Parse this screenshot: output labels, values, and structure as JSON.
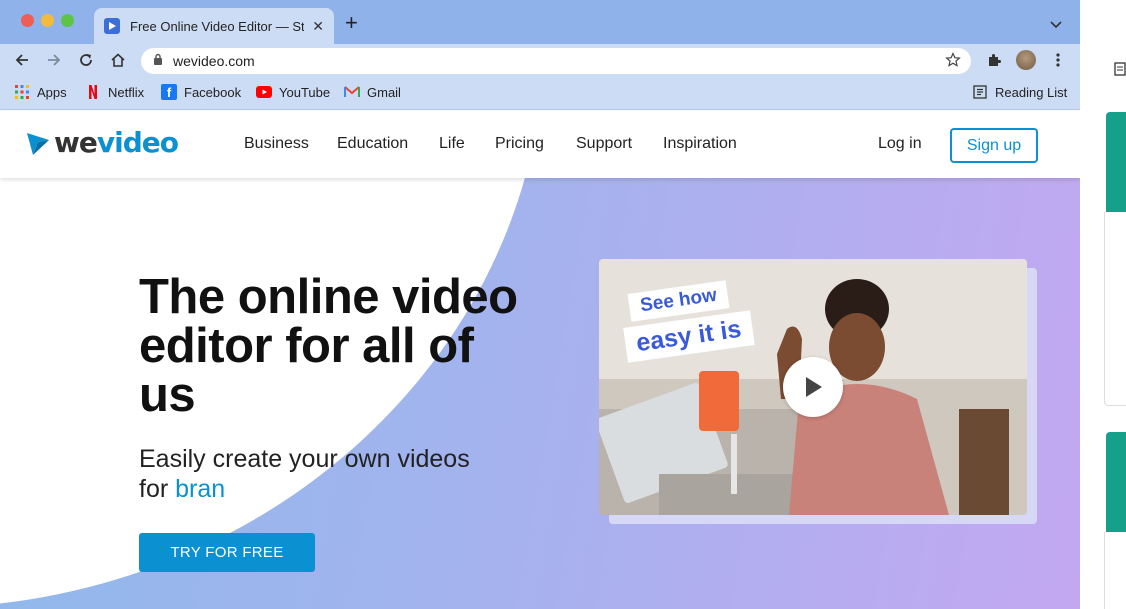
{
  "browser": {
    "tab_title": "Free Online Video Editor — Sta",
    "url": "wevideo.com",
    "bookmarks": [
      {
        "label": "Apps",
        "icon": "apps-grid-icon"
      },
      {
        "label": "Netflix",
        "icon": "netflix-icon"
      },
      {
        "label": "Facebook",
        "icon": "facebook-icon"
      },
      {
        "label": "YouTube",
        "icon": "youtube-icon"
      },
      {
        "label": "Gmail",
        "icon": "gmail-icon"
      }
    ],
    "reading_list": "Reading List"
  },
  "site": {
    "logo_we": "we",
    "logo_video": "video",
    "nav": [
      "Business",
      "Education",
      "Life",
      "Pricing",
      "Support",
      "Inspiration"
    ],
    "login": "Log in",
    "signup": "Sign up"
  },
  "hero": {
    "headline": "The online video editor for all of us",
    "sub_prefix": "Easily create your own videos for ",
    "sub_accent": "bran",
    "cta": "TRY FOR FREE",
    "sticker_top": "See how",
    "sticker_bottom": "easy it is"
  },
  "colors": {
    "brand_blue": "#0b91d1",
    "sticker_text": "#3a5bd9",
    "tab_strip": "#8fb2ea",
    "toolbar": "#cddcf5",
    "hero_gradient_start": "#8fb9ea",
    "hero_gradient_end": "#c3a8f0",
    "sliver_green": "#14a089"
  }
}
